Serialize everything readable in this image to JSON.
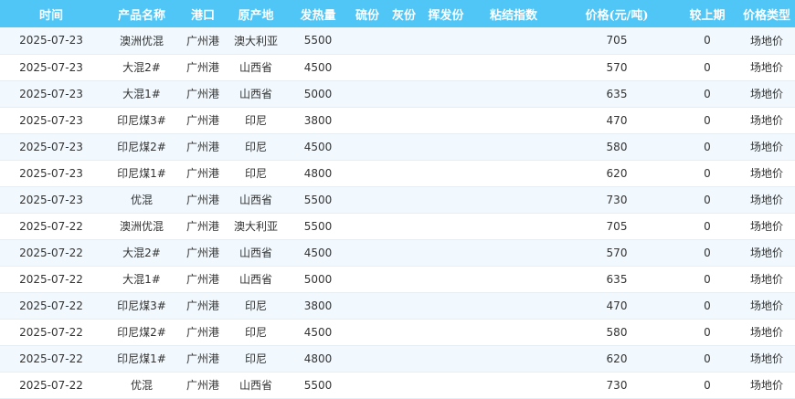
{
  "table": {
    "headers": [
      "时间",
      "产品名称",
      "港口",
      "原产地",
      "发热量",
      "硫份",
      "灰份",
      "挥发份",
      "粘结指数",
      "价格(元/吨)",
      "较上期",
      "价格类型"
    ],
    "rows": [
      [
        "2025-07-23",
        "澳洲优混",
        "广州港",
        "澳大利亚",
        "5500",
        "",
        "",
        "",
        "",
        "705",
        "0",
        "场地价"
      ],
      [
        "2025-07-23",
        "大混2#",
        "广州港",
        "山西省",
        "4500",
        "",
        "",
        "",
        "",
        "570",
        "0",
        "场地价"
      ],
      [
        "2025-07-23",
        "大混1#",
        "广州港",
        "山西省",
        "5000",
        "",
        "",
        "",
        "",
        "635",
        "0",
        "场地价"
      ],
      [
        "2025-07-23",
        "印尼煤3#",
        "广州港",
        "印尼",
        "3800",
        "",
        "",
        "",
        "",
        "470",
        "0",
        "场地价"
      ],
      [
        "2025-07-23",
        "印尼煤2#",
        "广州港",
        "印尼",
        "4500",
        "",
        "",
        "",
        "",
        "580",
        "0",
        "场地价"
      ],
      [
        "2025-07-23",
        "印尼煤1#",
        "广州港",
        "印尼",
        "4800",
        "",
        "",
        "",
        "",
        "620",
        "0",
        "场地价"
      ],
      [
        "2025-07-23",
        "优混",
        "广州港",
        "山西省",
        "5500",
        "",
        "",
        "",
        "",
        "730",
        "0",
        "场地价"
      ],
      [
        "2025-07-22",
        "澳洲优混",
        "广州港",
        "澳大利亚",
        "5500",
        "",
        "",
        "",
        "",
        "705",
        "0",
        "场地价"
      ],
      [
        "2025-07-22",
        "大混2#",
        "广州港",
        "山西省",
        "4500",
        "",
        "",
        "",
        "",
        "570",
        "0",
        "场地价"
      ],
      [
        "2025-07-22",
        "大混1#",
        "广州港",
        "山西省",
        "5000",
        "",
        "",
        "",
        "",
        "635",
        "0",
        "场地价"
      ],
      [
        "2025-07-22",
        "印尼煤3#",
        "广州港",
        "印尼",
        "3800",
        "",
        "",
        "",
        "",
        "470",
        "0",
        "场地价"
      ],
      [
        "2025-07-22",
        "印尼煤2#",
        "广州港",
        "印尼",
        "4500",
        "",
        "",
        "",
        "",
        "580",
        "0",
        "场地价"
      ],
      [
        "2025-07-22",
        "印尼煤1#",
        "广州港",
        "印尼",
        "4800",
        "",
        "",
        "",
        "",
        "620",
        "0",
        "场地价"
      ],
      [
        "2025-07-22",
        "优混",
        "广州港",
        "山西省",
        "5500",
        "",
        "",
        "",
        "",
        "730",
        "0",
        "场地价"
      ]
    ]
  },
  "colors": {
    "header_bg": "#50c6f6",
    "header_text": "#ffffff",
    "row_stripe": "#f1f9fe"
  }
}
